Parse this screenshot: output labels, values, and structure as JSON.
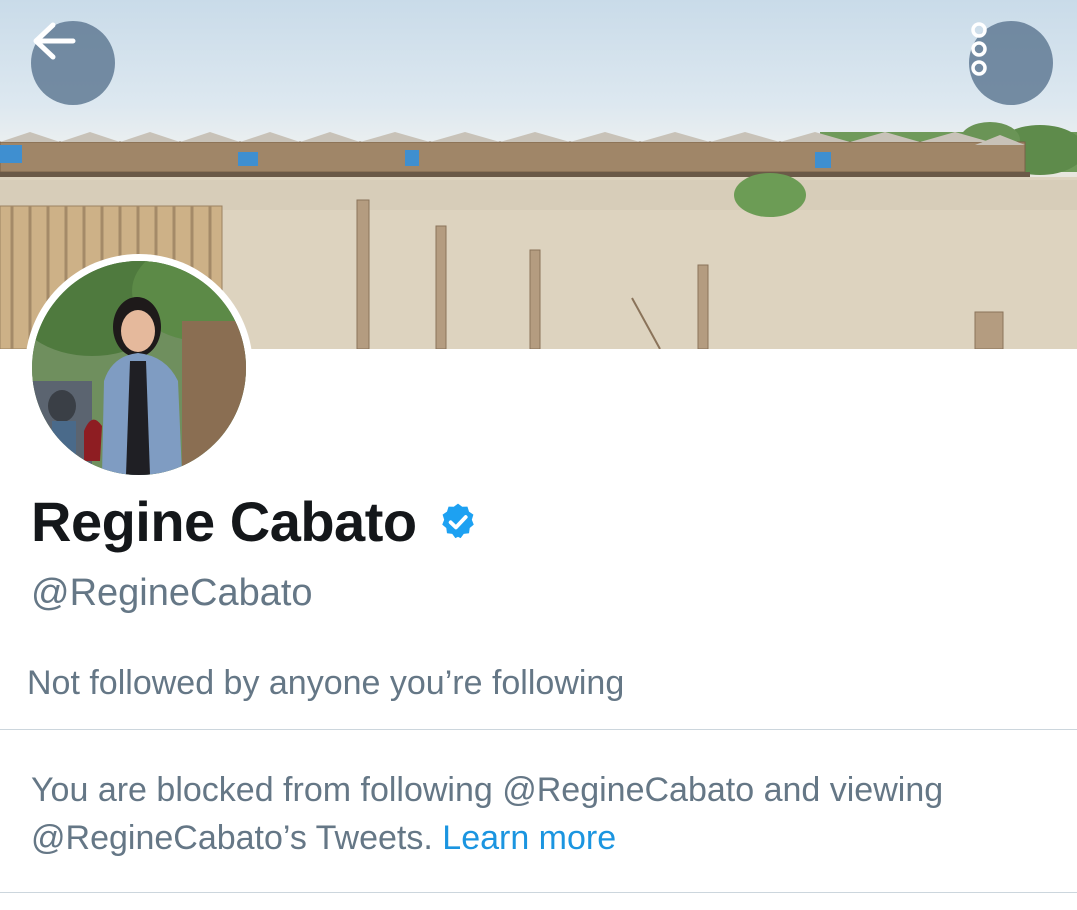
{
  "header": {
    "back_icon": "arrow-left-icon",
    "more_icon": "more-vertical-icon"
  },
  "profile": {
    "display_name": "Regine Cabato",
    "verified_icon": "verified-badge-icon",
    "handle": "@RegineCabato",
    "followed_by_text": "Not followed by anyone you’re following"
  },
  "block_notice": {
    "text": "You are blocked from following @RegineCabato and viewing @RegineCabato’s Tweets.",
    "link_label": "Learn more"
  },
  "colors": {
    "accent": "#1b95e0",
    "verified": "#1da1f2",
    "secondary_text": "#657786",
    "primary_text": "#14171a"
  }
}
